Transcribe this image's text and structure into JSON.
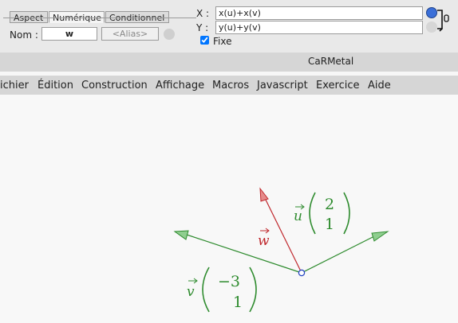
{
  "properties": {
    "tabs": [
      "Aspect",
      "Numérique",
      "Conditionnel"
    ],
    "name_label": "Nom :",
    "name_value": "w",
    "alias_placeholder": "<Alias>",
    "x_label": "X :",
    "x_value": "x(u)+x(v)",
    "y_label": "Y :",
    "y_value": "y(u)+y(v)",
    "fixe_label": "Fixe",
    "fixe_checked": true
  },
  "window": {
    "title": "CaRMetal"
  },
  "menu": [
    "ichier",
    "Édition",
    "Construction",
    "Affichage",
    "Macros",
    "Javascript",
    "Exercice",
    "Aide"
  ],
  "canvas": {
    "vector_u_name": "u",
    "vector_u_coords": [
      "2",
      "1"
    ],
    "vector_v_name": "v",
    "vector_v_coords": [
      "−3",
      "1"
    ],
    "vector_w_name": "w",
    "colors": {
      "green": "#2e8b2e",
      "red": "#c0282d",
      "point": "#2040c0"
    }
  }
}
